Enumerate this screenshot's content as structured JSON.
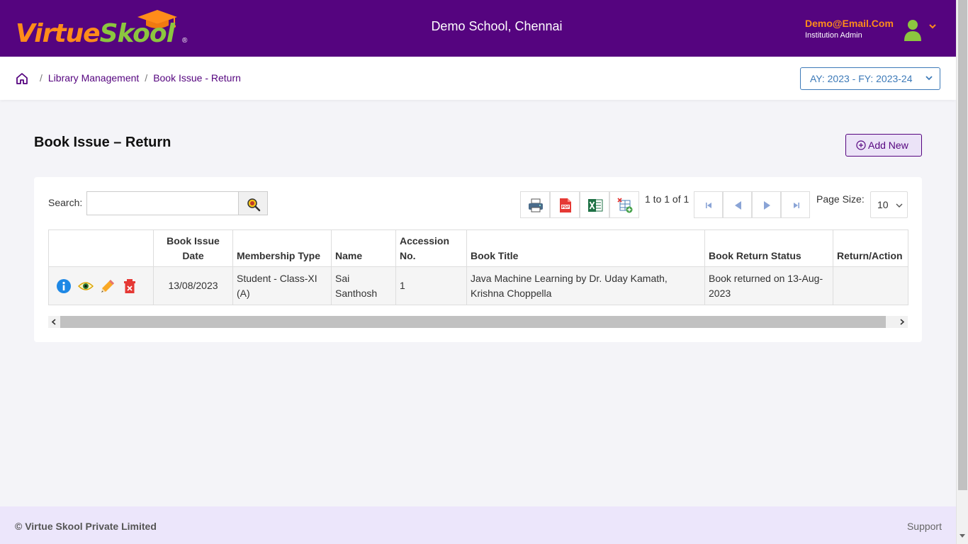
{
  "header": {
    "logo_part1": "Virtue",
    "logo_part2": "Skool",
    "logo_reg": "®",
    "school_name": "Demo School, Chennai",
    "user_email": "Demo@Email.Com",
    "user_role": "Institution Admin"
  },
  "breadcrumb": {
    "items": [
      "Library Management",
      "Book Issue - Return"
    ],
    "separator": "/"
  },
  "academic_year": "AY: 2023 - FY: 2023-24",
  "page": {
    "title": "Book Issue – Return",
    "add_new_label": "Add New"
  },
  "toolbar": {
    "search_label": "Search:",
    "search_value": "",
    "page_info": "1 to 1 of 1",
    "page_size_label": "Page Size:",
    "page_size_value": "10"
  },
  "table": {
    "columns": [
      "",
      "Book Issue Date",
      "Membership Type",
      "Name",
      "Accession No.",
      "Book Title",
      "Book Return Status",
      "Return/Action"
    ],
    "rows": [
      {
        "issue_date": "13/08/2023",
        "membership_type": "Student - Class-XI (A)",
        "name": "Sai Santhosh",
        "accession_no": "1",
        "book_title": "Java Machine Learning by Dr. Uday Kamath, Krishna Choppella",
        "return_status": "Book returned on 13-Aug-2023",
        "return_action": ""
      }
    ]
  },
  "footer": {
    "copyright": "© Virtue Skool Private Limited",
    "support": "Support"
  },
  "colors": {
    "brand_purple": "#55047f",
    "logo_orange": "#ff8c1a",
    "logo_green": "#8cc63f",
    "footer_bg": "#ece6fb"
  }
}
